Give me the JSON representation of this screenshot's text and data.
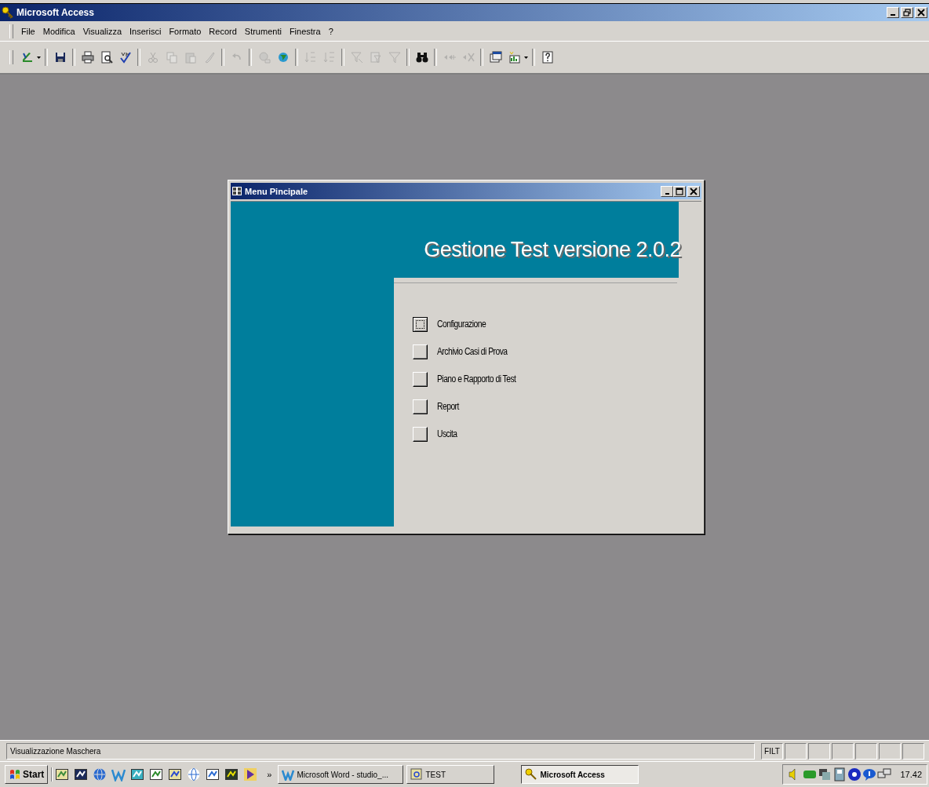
{
  "window": {
    "title": "Microsoft Access"
  },
  "menu": [
    "File",
    "Modifica",
    "Visualizza",
    "Inserisci",
    "Formato",
    "Record",
    "Strumenti",
    "Finestra",
    "?"
  ],
  "toolbar": [
    {
      "disabled": false
    },
    {
      "disabled": false
    },
    {
      "disabled": false
    },
    {
      "disabled": false
    },
    {
      "disabled": false
    },
    {
      "disabled": true
    },
    {
      "disabled": true
    },
    {
      "disabled": true
    },
    {
      "disabled": true
    },
    {
      "disabled": true
    },
    {
      "disabled": true
    },
    {
      "disabled": false
    },
    {
      "disabled": true
    },
    {
      "disabled": true
    },
    {
      "disabled": true
    },
    {
      "disabled": true
    },
    {
      "disabled": true
    },
    {
      "disabled": false
    },
    {
      "disabled": true
    },
    {
      "disabled": true
    },
    {
      "disabled": false
    },
    {
      "disabled": false
    },
    {
      "disabled": false
    }
  ],
  "form": {
    "title": "Menu Pincipale",
    "heading": "Gestione Test versione 2.0.2",
    "items": [
      {
        "label": "Configurazione",
        "focused": true
      },
      {
        "label": "Archivio Casi di Prova",
        "focused": false
      },
      {
        "label": "Piano e Rapporto di Test",
        "focused": false
      },
      {
        "label": "Report",
        "focused": false
      },
      {
        "label": "Uscita",
        "focused": false
      }
    ]
  },
  "status_bar": {
    "text": "Visualizzazione Maschera",
    "panels": [
      "FILT"
    ]
  },
  "taskbar": {
    "start": "Start",
    "more": "»",
    "tasks": [
      {
        "label": "Microsoft Word - studio_...",
        "selected": false
      },
      {
        "label": "TEST",
        "selected": false
      },
      {
        "label": "Microsoft Access",
        "selected": true
      }
    ],
    "clock": "17.42"
  }
}
